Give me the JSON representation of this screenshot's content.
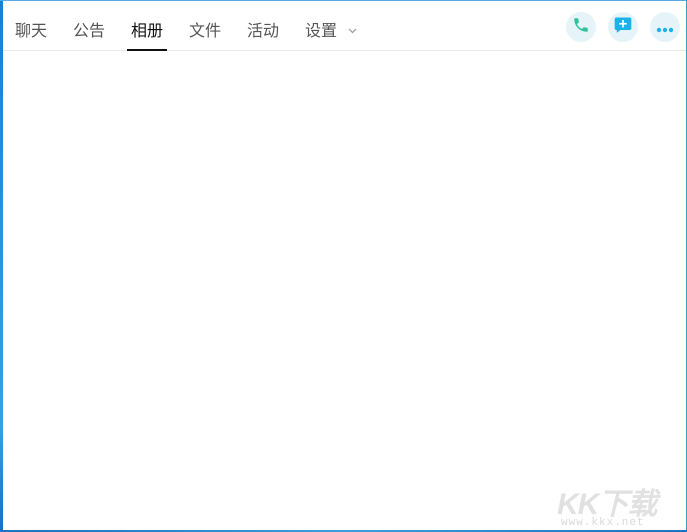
{
  "tabs": [
    {
      "label": "聊天"
    },
    {
      "label": "公告"
    },
    {
      "label": "相册"
    },
    {
      "label": "文件"
    },
    {
      "label": "活动"
    },
    {
      "label": "设置"
    }
  ],
  "active_tab": "相册",
  "actions": [
    {
      "name": "phone-call",
      "icon": "phone-icon"
    },
    {
      "name": "new-message",
      "icon": "chat-plus-icon"
    },
    {
      "name": "more",
      "icon": "more-dots-icon"
    }
  ],
  "colors": {
    "accent": "#1ab2e8",
    "phone_icon": "#2ec29a",
    "action_bg": "#e6f4fa",
    "active_underline": "#111111"
  },
  "watermark": {
    "brand": "KK下载",
    "url": "www.kkx.net"
  }
}
